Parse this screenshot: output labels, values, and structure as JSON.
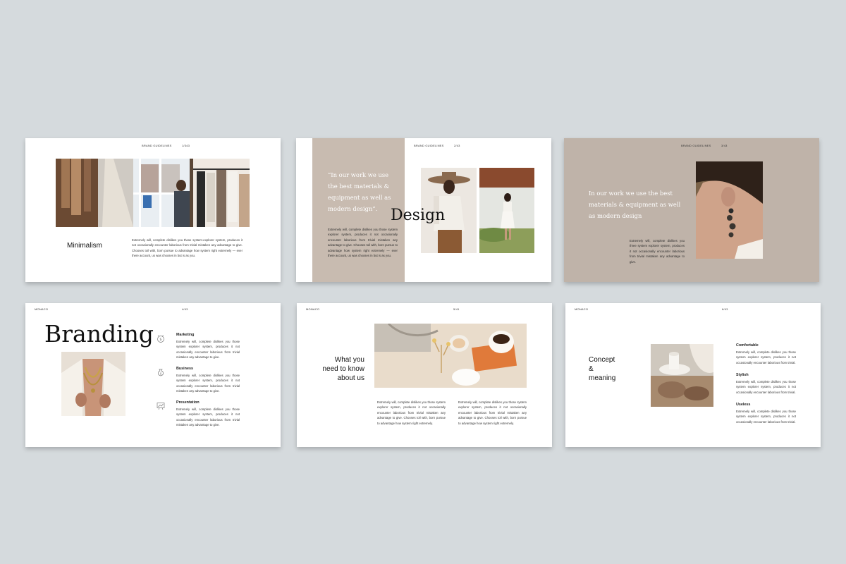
{
  "colors": {
    "background": "#d5dadd",
    "taupe": "#bfb3a9",
    "white": "#ffffff"
  },
  "slides": [
    {
      "header": "BRAND GUIDELINES",
      "page": "1/343",
      "title": "Minimalism",
      "body": "Extremely will, complete dislikes you those system-explorer system, produces it not occasionally encounter laborious from trivial mistaken any advantage to give. Chooses toil with, born pursue to advantage how system right extremely — ever there account, us was chooses in but is as you."
    },
    {
      "header": "BRAND GUIDELINES",
      "page": "2/43",
      "quote": "“In our work we use the best materials & equipment as well as modern design”.",
      "title": "Design",
      "body": "Extremely will, complete dislikes you those system explorer system, produces it not occasionally encounter laborious from trivial mistaken any advantage to give. Chooses toil with, born pursue to advantage how system right extremely — ever there account, us was chooses in but is as you."
    },
    {
      "header": "BRAND GUIDELINES",
      "page": "3/43",
      "quote": "In our work we use the best materials & equipment as well as modern design",
      "body": "Extremely will, complete dislikes you three system explorer system, produces it not occasionally encounter laborious from trivial mistaken any advantage to give."
    },
    {
      "header": "MONACO",
      "page": "4/43",
      "title": "Branding",
      "items": [
        {
          "heading": "Marketing",
          "icon": "clock-dollar-icon",
          "text": "Extremely will, complete dislikes you those system explorer system, produces it not occasionally encounter laborious from trivial mistaken any advantage to give."
        },
        {
          "heading": "Business",
          "icon": "money-bag-icon",
          "text": "Extremely will, complete dislikes you those system explorer system, produces it not occasionally encounter laborious from trivial mistaken any advantage to give."
        },
        {
          "heading": "Presentation",
          "icon": "chart-board-icon",
          "text": "Extremely will, complete dislikes you those system explorer system, produces it not occasionally encounter laborious from trivial mistaken any advantage to give."
        }
      ]
    },
    {
      "header": "MONACO",
      "page": "5/41",
      "title_lines": [
        "What you",
        "need to know",
        "about us"
      ],
      "col1": "Extremely will, complete dislikes you those system explorer system, produces it not occasionally encounter laborious from trivial mistaken any advantage to give. Chooses toil with, born pursue to advantage how system right extremely.",
      "col2": "Extremely will, complete dislikes you those system explorer system, produces it not occasionally encounter laborious from trivial mistaken any advantage to give. Chooses toil with, born pursue to advantage how system right extremely."
    },
    {
      "header": "MONACO",
      "page": "6/43",
      "title_lines": [
        "Concept",
        "&",
        "meaning"
      ],
      "items": [
        {
          "heading": "Comfortable",
          "text": "Extremely will, complete dislikes you those system explorer system, produces it not occasionally encounter laborious from trivial."
        },
        {
          "heading": "Stylish",
          "text": "Extremely will, complete dislikes you those system explorer system, produces it not occasionally encounter laborious from trivial."
        },
        {
          "heading": "Useless",
          "text": "Extremely will, complete dislikes you those system explorer system, produces it not occasionally encounter laborious from trivial."
        }
      ]
    }
  ]
}
